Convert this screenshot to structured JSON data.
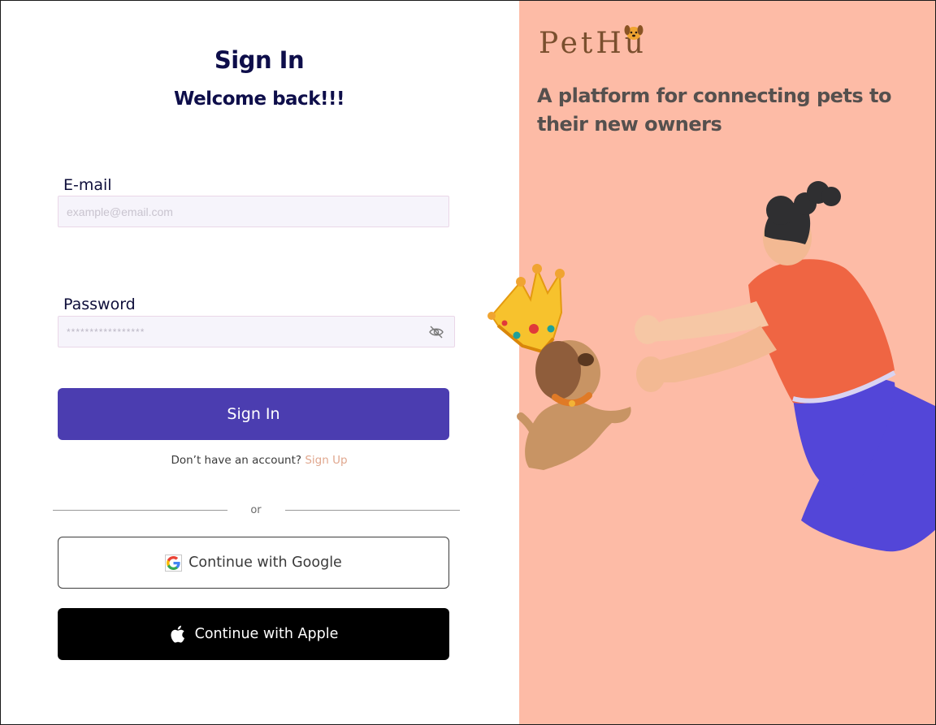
{
  "signin": {
    "title": "Sign In",
    "subtitle": "Welcome back!!!",
    "email_label": "E-mail",
    "email_placeholder": "example@email.com",
    "password_label": "Password",
    "password_placeholder": "*****************",
    "submit_label": "Sign In",
    "no_account_text": "Don’t have an account?",
    "signup_link": "Sign Up",
    "divider_text": "or",
    "google_label": "Continue with Google",
    "apple_label": "Continue with Apple"
  },
  "brand": {
    "logo_text": "PetHu",
    "tagline": "A platform for connecting pets to their new owners"
  },
  "colors": {
    "primary": "#4b3db0",
    "brand_panel": "#fdbba6",
    "heading": "#0e0e4a",
    "link": "#e0a78e"
  },
  "icons": [
    "eye-slash-icon",
    "google-icon",
    "apple-icon",
    "dog-logo-icon"
  ]
}
